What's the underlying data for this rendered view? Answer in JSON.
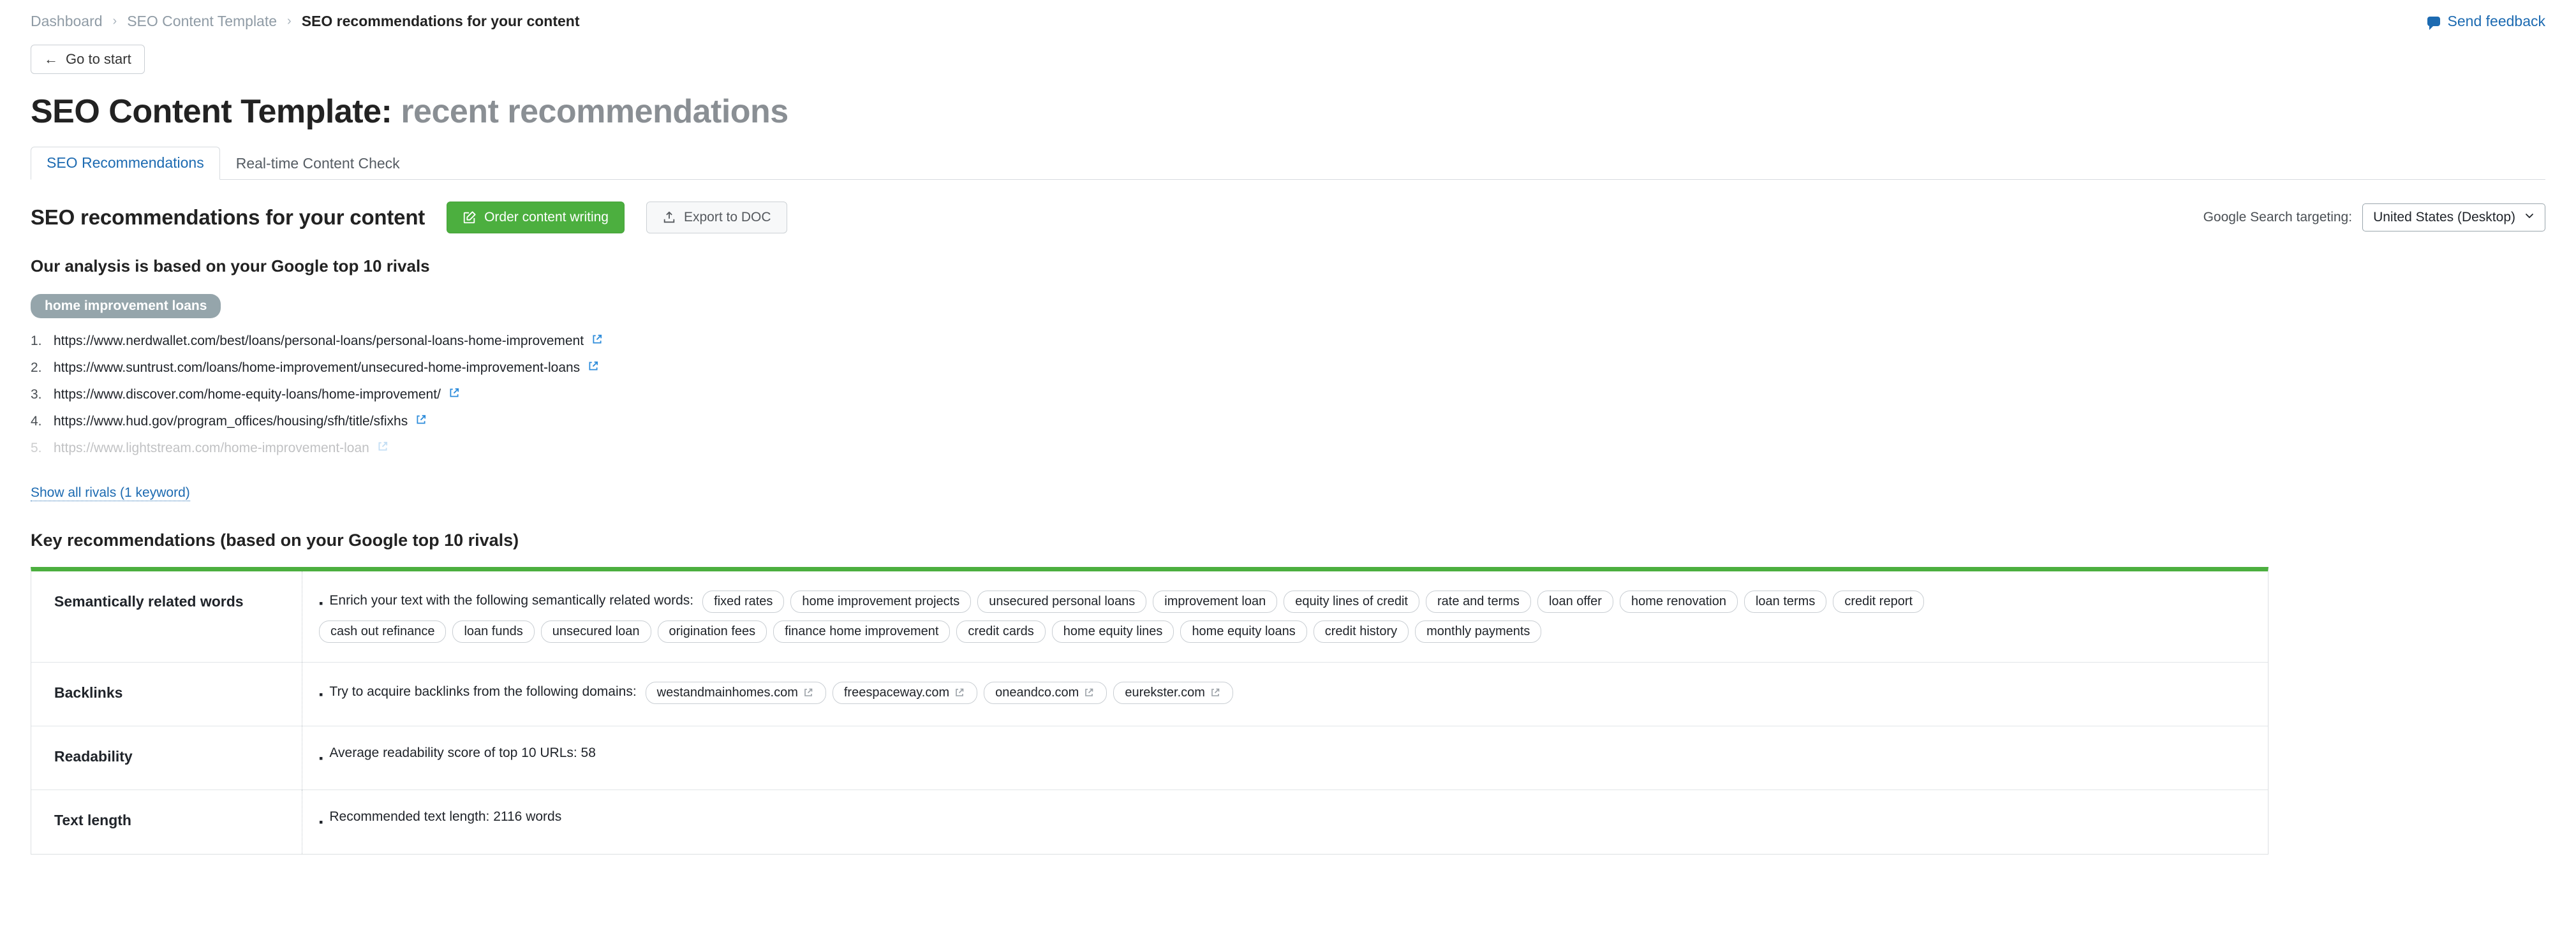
{
  "breadcrumb": {
    "items": [
      "Dashboard",
      "SEO Content Template",
      "SEO recommendations for your content"
    ],
    "separator": "›"
  },
  "feedback": {
    "label": "Send feedback",
    "icon": "speech-bubble-icon",
    "color": "#1c6ab1"
  },
  "go_to_start": {
    "label": "Go to start",
    "icon": "arrow-left-icon"
  },
  "page_title": {
    "strong": "SEO Content Template:",
    "light": "recent recommendations"
  },
  "tabs": [
    {
      "label": "SEO Recommendations",
      "active": true
    },
    {
      "label": "Real-time Content Check",
      "active": false
    }
  ],
  "section": {
    "title": "SEO recommendations for your content",
    "order_button": {
      "label": "Order content writing",
      "icon": "edit-square-icon",
      "color": "#4caf3f"
    },
    "export_button": {
      "label": "Export to DOC",
      "icon": "upload-icon"
    }
  },
  "targeting": {
    "label": "Google Search targeting:",
    "value": "United States (Desktop)",
    "chevron": "⌄"
  },
  "analysis": {
    "title": "Our analysis is based on your Google top 10 rivals",
    "keyword": "home improvement loans",
    "rivals": [
      {
        "num": "1.",
        "url": "https://www.nerdwallet.com/best/loans/personal-loans/personal-loans-home-improvement"
      },
      {
        "num": "2.",
        "url": "https://www.suntrust.com/loans/home-improvement/unsecured-home-improvement-loans"
      },
      {
        "num": "3.",
        "url": "https://www.discover.com/home-equity-loans/home-improvement/"
      },
      {
        "num": "4.",
        "url": "https://www.hud.gov/program_offices/housing/sfh/title/sfixhs"
      },
      {
        "num": "5.",
        "url": "https://www.lightstream.com/home-improvement-loan"
      }
    ],
    "show_all_rivals": "Show all rivals (1 keyword)"
  },
  "key_recommendations": {
    "title": "Key recommendations (based on your Google top 10 rivals)",
    "accent_color": "#4caf3f",
    "rows": [
      {
        "label": "Semantically related words",
        "text": "Enrich your text with the following semantically related words:",
        "chips_row1": [
          "fixed rates",
          "home improvement projects",
          "unsecured personal loans",
          "improvement loan",
          "equity lines of credit",
          "rate and terms",
          "loan offer",
          "home renovation",
          "loan terms",
          "credit report"
        ],
        "chips_row2": [
          "cash out refinance",
          "loan funds",
          "unsecured loan",
          "origination fees",
          "finance home improvement",
          "credit cards",
          "home equity lines",
          "home equity loans",
          "credit history",
          "monthly payments"
        ]
      },
      {
        "label": "Backlinks",
        "text": "Try to acquire backlinks from the following domains:",
        "chips_row1": [
          "westandmainhomes.com",
          "freespaceway.com",
          "oneandco.com",
          "eurekster.com"
        ],
        "chips_row2": []
      },
      {
        "label": "Readability",
        "text": "Average readability score of top 10 URLs:  58",
        "chips_row1": [],
        "chips_row2": []
      },
      {
        "label": "Text length",
        "text": "Recommended text length: 2116 words",
        "chips_row1": [],
        "chips_row2": []
      }
    ]
  }
}
